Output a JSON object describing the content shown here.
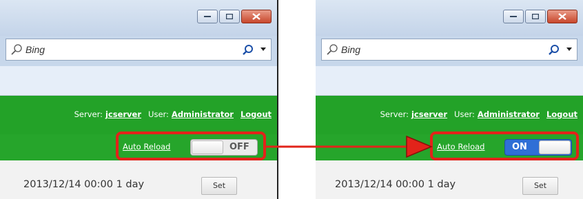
{
  "search": {
    "placeholder": "Bing"
  },
  "header": {
    "server_label": "Server:",
    "server_value": "jcserver",
    "user_label": "User:",
    "user_value": "Administrator",
    "logout_label": "Logout"
  },
  "autoreload": {
    "link_label": "Auto Reload",
    "before_state": "OFF",
    "after_state": "ON"
  },
  "content": {
    "date_text": "2013/12/14 00:00 1 day",
    "set_label": "Set"
  },
  "colors": {
    "green_bar": "#23a228",
    "highlight": "#e2231a",
    "toggle_on": "#2f6fd6",
    "toggle_off": "#ebebeb"
  },
  "icons": [
    "search-icon",
    "search-go-icon",
    "dropdown-arrow-icon",
    "minimize-icon",
    "maximize-icon",
    "close-icon",
    "arrow-icon"
  ]
}
